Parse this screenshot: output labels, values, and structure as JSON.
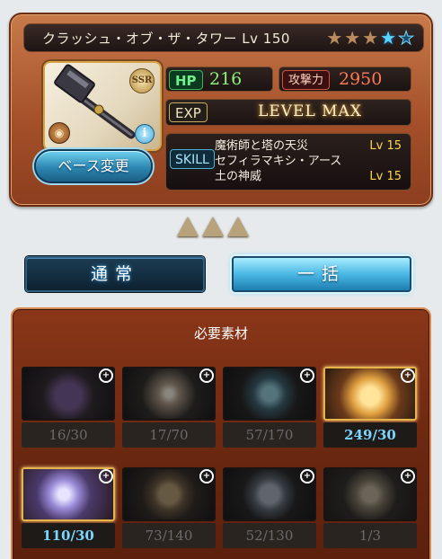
{
  "weapon": {
    "name": "クラッシュ・オブ・ザ・タワー Lv 150",
    "rarity": "SSR",
    "stars": [
      "bronze",
      "bronze",
      "bronze",
      "blue",
      "empty"
    ],
    "hp_label": "HP",
    "hp": "216",
    "atk_label": "攻撃力",
    "atk": "2950",
    "exp_label": "EXP",
    "exp_value": "LEVEL MAX",
    "base_change_label": "ベース変更",
    "skill_label": "SKILL",
    "skills": [
      {
        "name": "魔術師と塔の天災",
        "level": "Lv 15"
      },
      {
        "name": "セフィラマキシ・アース",
        "level": ""
      },
      {
        "name": "土の神威",
        "level": "Lv 15"
      }
    ]
  },
  "modes": {
    "normal_label": "通常",
    "bulk_label": "一括"
  },
  "materials": {
    "title": "必要素材",
    "items": [
      {
        "icon": "purple-crystal-icon",
        "count": "16/30",
        "sufficient": false,
        "color": "#6a3f8e"
      },
      {
        "icon": "starburst-icon",
        "count": "17/70",
        "sufficient": false,
        "color": "#7a6a5a"
      },
      {
        "icon": "blue-shard-icon",
        "count": "57/170",
        "sufficient": false,
        "color": "#2f6a84"
      },
      {
        "icon": "golden-crown-crystal-icon",
        "count": "249/30",
        "sufficient": true,
        "color": "#e0a040"
      },
      {
        "icon": "hexagon-orb-icon",
        "count": "110/30",
        "sufficient": true,
        "color": "#8a88c8"
      },
      {
        "icon": "bronze-medallion-icon",
        "count": "73/140",
        "sufficient": false,
        "color": "#8a6a40"
      },
      {
        "icon": "silver-seal-icon",
        "count": "52/130",
        "sufficient": false,
        "color": "#6a7a8a"
      },
      {
        "icon": "hourglass-idol-icon",
        "count": "1/3",
        "sufficient": false,
        "color": "#8a7a5a"
      }
    ]
  }
}
